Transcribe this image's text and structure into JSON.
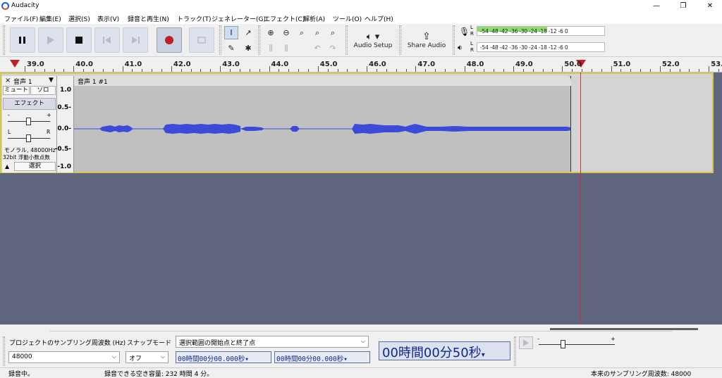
{
  "window": {
    "title": "Audacity",
    "minimize": "—",
    "maximize": "❐",
    "close": "✕"
  },
  "menu": [
    "ファイル(F)",
    "編集(E)",
    "選択(S)",
    "表示(V)",
    "録音と再生(N)",
    "トラック(T)",
    "ジェネレーター(G)",
    "エフェクト(C)",
    "解析(A)",
    "ツール(O)",
    "ヘルプ(H)"
  ],
  "toolbar": {
    "audio_setup": "Audio Setup",
    "share_audio": "Share Audio",
    "meter_ticks": "-54  -48  -42  -36  -30  -24  -18  -12   -6   0",
    "meter_L": "L",
    "meter_R": "R",
    "record_meter_level": 0.55
  },
  "ruler": {
    "ticks": [
      "39.0",
      "40.0",
      "41.0",
      "42.0",
      "43.0",
      "44.0",
      "45.0",
      "46.0",
      "47.0",
      "48.0",
      "49.0",
      "50.0",
      "51.0",
      "52.0",
      "53.0"
    ]
  },
  "track": {
    "name": "音声 1",
    "close": "×",
    "mute": "ミュート",
    "solo": "ソロ",
    "effects": "エフェクト",
    "gain_minus": "-",
    "gain_plus": "+",
    "pan_left": "L",
    "pan_right": "R",
    "info1": "モノラル, 48000Hz",
    "info2": "32bit 浮動小数点数",
    "select": "選択",
    "clip_name": "音声 1 #1",
    "scale": [
      "1.0",
      "0.5-",
      "0.0-",
      "-0.5-",
      "-1.0"
    ]
  },
  "bottom": {
    "rate_label": "プロジェクトのサンプリング周波数 (Hz)",
    "snap_label": "スナップモード",
    "rate_value": "48000",
    "snap_value": "オフ",
    "selection_mode": "選択範囲の開始点と終了点",
    "sel_start": "00時間00分00.000秒",
    "sel_end": "00時間00分00.000秒",
    "big_time": "00時間00分50秒"
  },
  "status": {
    "left": "録音中。",
    "mid": "録音できる空き容量: 232 時間 4 分。",
    "right": "本来のサンプリング周波数: 48000"
  }
}
